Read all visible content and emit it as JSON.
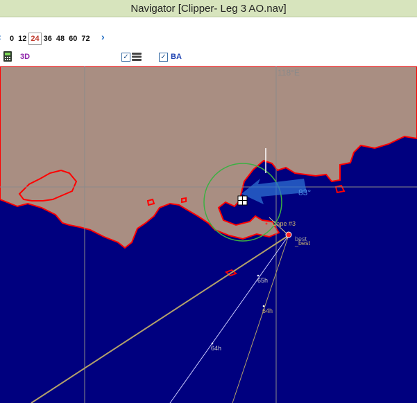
{
  "window": {
    "title": "Navigator [Clipper- Leg 3 AO.nav]"
  },
  "toolbar": {
    "hours": [
      "0",
      "12",
      "24",
      "36",
      "48",
      "60",
      "72"
    ],
    "selected_hour": "24",
    "view_3d_label": "3D",
    "layers_checkbox_checked": true,
    "ba_checkbox_checked": true,
    "ba_label": "BA"
  },
  "map": {
    "longitude_label": "118°E",
    "heading_label": "83°",
    "waypoint_label": "Cape #3",
    "route_label_1": "best",
    "route_label_2": "_best",
    "time_markers": [
      "65h",
      "64h",
      "64h"
    ],
    "colors": {
      "sea": "#00007f",
      "land": "#a98e82",
      "coast": "#ff0000",
      "track": "#b3a16a"
    }
  }
}
